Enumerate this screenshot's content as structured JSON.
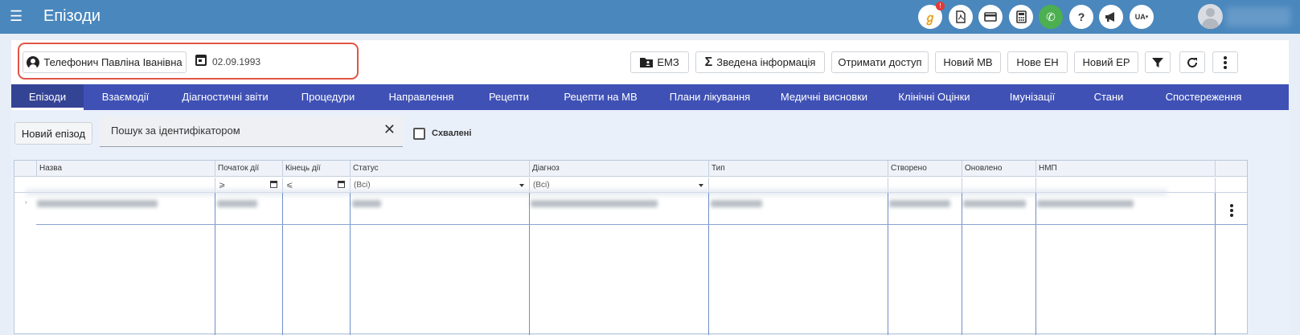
{
  "header": {
    "title": "Епізоди",
    "notification_badge": "!",
    "lang": "UA",
    "icons": [
      "ai-assistant-icon",
      "pdf-icon",
      "card-icon",
      "calculator-icon",
      "phone-icon",
      "help-icon",
      "megaphone-icon",
      "language-icon"
    ]
  },
  "patient": {
    "name": "Телефонич Павліна Іванівна",
    "dob": "02.09.1993"
  },
  "actions": {
    "emz": "ЕМЗ",
    "summary": "Зведена інформація",
    "get_access": "Отримати доступ",
    "new_mv": "Новий МВ",
    "new_en": "Нове ЕН",
    "new_er": "Новий ЕР"
  },
  "tabs": [
    {
      "label": "Епізоди",
      "active": true
    },
    {
      "label": "Взаємодії"
    },
    {
      "label": "Діагностичні звіти"
    },
    {
      "label": "Процедури"
    },
    {
      "label": "Направлення"
    },
    {
      "label": "Рецепти"
    },
    {
      "label": "Рецепти на МВ"
    },
    {
      "label": "Плани лікування"
    },
    {
      "label": "Медичні висновки"
    },
    {
      "label": "Клінічні Оцінки"
    },
    {
      "label": "Імунізації"
    },
    {
      "label": "Стани"
    },
    {
      "label": "Спостереження"
    }
  ],
  "toolbar": {
    "new_episode": "Новий епізод",
    "search_label": "Пошук за ідентифікатором",
    "approved_label": "Схвалені"
  },
  "grid": {
    "columns": [
      "Назва",
      "Початок дії",
      "Кінець дії",
      "Статус",
      "Діагноз",
      "Тип",
      "Створено",
      "Оновлено",
      "НМП"
    ],
    "filters": {
      "start": "⩾",
      "end": "⩽",
      "status": "(Всі)",
      "diagnosis": "(Всі)"
    }
  },
  "colors": {
    "topbar": "#4a87bd",
    "nav": "#3f51b5",
    "highlight": "#e05545"
  }
}
